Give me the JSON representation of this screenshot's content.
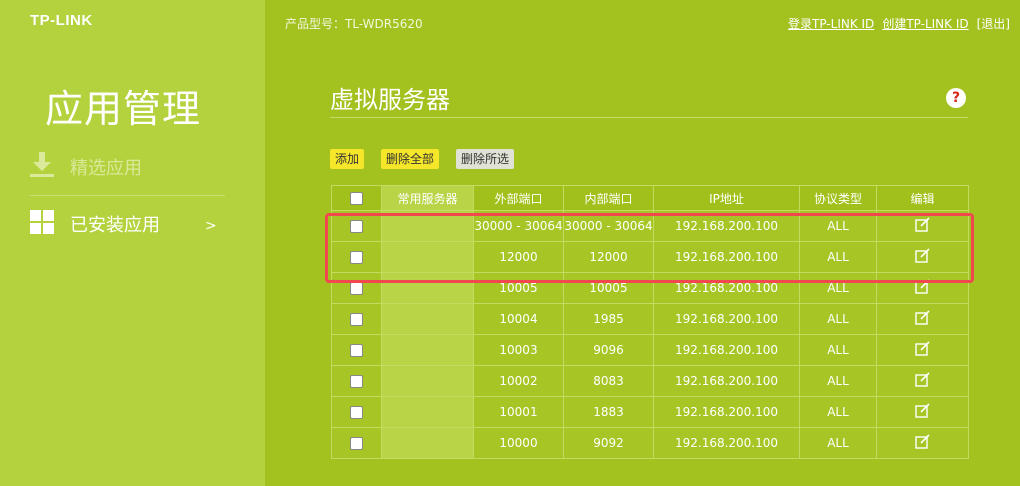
{
  "brand": {
    "logo": "TP-LINK"
  },
  "header": {
    "model": "产品型号：TL-WDR5620",
    "login_link": "登录TP-LINK ID",
    "create_link": "创建TP-LINK ID",
    "logout": "[退出]"
  },
  "sidebar": {
    "title": "应用管理",
    "items": [
      {
        "label": "精选应用",
        "icon": "download-icon"
      },
      {
        "label": "已安装应用",
        "icon": "grid-icon",
        "arrow": ">"
      }
    ]
  },
  "main": {
    "title": "虚拟服务器",
    "help": "?",
    "buttons": {
      "add": "添加",
      "delete_all": "删除全部",
      "delete_selected": "删除所选"
    }
  },
  "table": {
    "headers": [
      "常用服务器",
      "外部端口",
      "内部端口",
      "IP地址",
      "协议类型",
      "编辑"
    ],
    "rows": [
      {
        "service": "",
        "ext": "30000 - 30064",
        "int": "30000 - 30064",
        "ip": "192.168.200.100",
        "proto": "ALL"
      },
      {
        "service": "",
        "ext": "12000",
        "int": "12000",
        "ip": "192.168.200.100",
        "proto": "ALL"
      },
      {
        "service": "",
        "ext": "10005",
        "int": "10005",
        "ip": "192.168.200.100",
        "proto": "ALL"
      },
      {
        "service": "",
        "ext": "10004",
        "int": "1985",
        "ip": "192.168.200.100",
        "proto": "ALL"
      },
      {
        "service": "",
        "ext": "10003",
        "int": "9096",
        "ip": "192.168.200.100",
        "proto": "ALL"
      },
      {
        "service": "",
        "ext": "10002",
        "int": "8083",
        "ip": "192.168.200.100",
        "proto": "ALL"
      },
      {
        "service": "",
        "ext": "10001",
        "int": "1883",
        "ip": "192.168.200.100",
        "proto": "ALL"
      },
      {
        "service": "",
        "ext": "10000",
        "int": "9092",
        "ip": "192.168.200.100",
        "proto": "ALL"
      }
    ]
  },
  "colors": {
    "background": "#a3c11f",
    "sidebar": "#b4d23d",
    "button_yellow": "#f5e62a",
    "highlight": "#f0484e",
    "help_red": "#d7261a"
  }
}
